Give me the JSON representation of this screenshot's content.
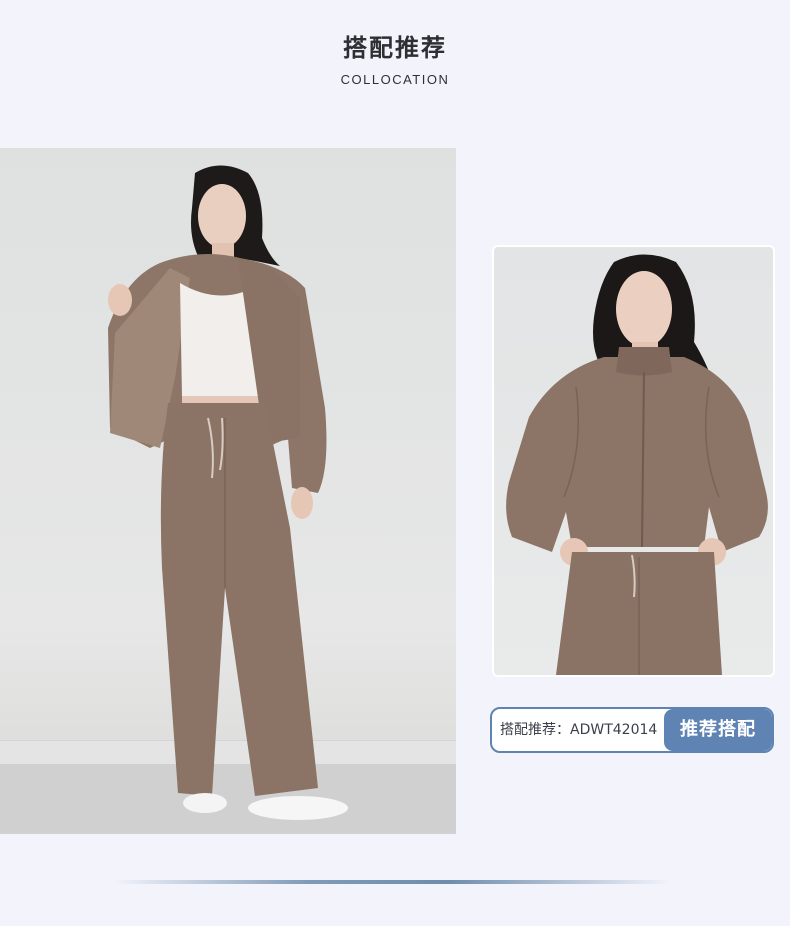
{
  "header": {
    "title": "搭配推荐",
    "subtitle": "COLLOCATION"
  },
  "recommendation": {
    "label": "搭配推荐：ADWT42014",
    "button_label": "推荐搭配"
  },
  "colors": {
    "background": "#f3f4fb",
    "accent": "#5f84b3",
    "garment": "#8b7466"
  }
}
